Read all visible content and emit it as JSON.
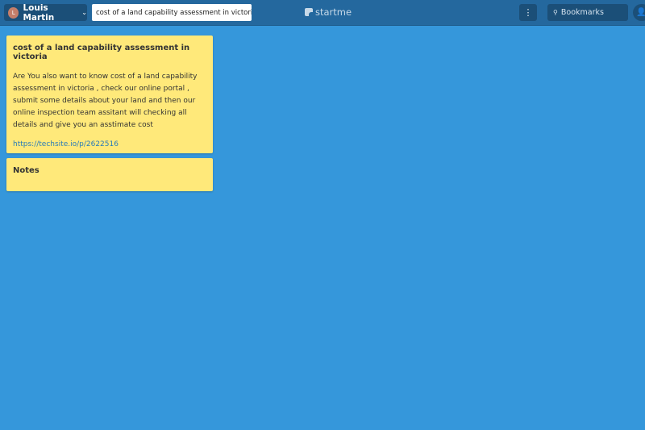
{
  "header": {
    "user": {
      "initial": "L",
      "name": "Louis Martin",
      "chevron": "⌄"
    },
    "page_title": "cost of a land capability assessment in victoria",
    "logo_text": "startme",
    "menu_icon": "vertical-dots",
    "search": {
      "label": "Bookmarks",
      "icon": "search"
    },
    "profile_icon": "person"
  },
  "widgets": [
    {
      "title": "cost of a land capability assessment in victoria",
      "description": "Are You also want to know cost of a land capability assessment in victoria , check our online portal , submit some details about your land and then our online inspection team assitant will checking all details and give you an asstimate cost",
      "link": "https://techsite.io/p/2622516"
    },
    {
      "title": "Notes"
    }
  ],
  "colors": {
    "background": "#3597db",
    "header": "#24689e",
    "widget": "#ffe97a",
    "link": "#2b7bb8"
  }
}
